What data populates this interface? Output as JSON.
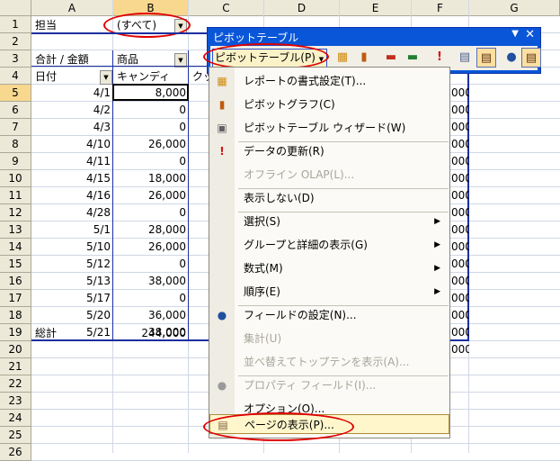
{
  "columns": [
    "A",
    "B",
    "C",
    "D",
    "E",
    "F",
    "G"
  ],
  "rows": [
    "1",
    "2",
    "3",
    "4",
    "5",
    "6",
    "7",
    "8",
    "9",
    "10",
    "11",
    "12",
    "13",
    "14",
    "15",
    "16",
    "17",
    "18",
    "19",
    "20",
    "21",
    "22",
    "23",
    "24",
    "25",
    "26"
  ],
  "page_field": {
    "label": "担当",
    "value": "(すべて)"
  },
  "pivot_header": {
    "data_label": "合計 / 金額",
    "col_field": "商品",
    "row_field": "日付",
    "col_item_b": "キャンディ",
    "col_item_c": "クッ"
  },
  "data_rows": [
    {
      "date": "4/1",
      "value": "8,000"
    },
    {
      "date": "4/2",
      "value": "0"
    },
    {
      "date": "4/3",
      "value": "0"
    },
    {
      "date": "4/10",
      "value": "26,000"
    },
    {
      "date": "4/11",
      "value": "0"
    },
    {
      "date": "4/15",
      "value": "18,000"
    },
    {
      "date": "4/16",
      "value": "26,000"
    },
    {
      "date": "4/28",
      "value": "0"
    },
    {
      "date": "5/1",
      "value": "28,000"
    },
    {
      "date": "5/10",
      "value": "26,000"
    },
    {
      "date": "5/12",
      "value": "0"
    },
    {
      "date": "5/13",
      "value": "38,000"
    },
    {
      "date": "5/17",
      "value": "0"
    },
    {
      "date": "5/20",
      "value": "36,000"
    },
    {
      "date": "5/21",
      "value": "38,000"
    }
  ],
  "total_row": {
    "label": "総計",
    "value": "244,000"
  },
  "col_f_partial": "000",
  "toolbar": {
    "title": "ピボットテーブル",
    "menu_button": "ピボットテーブル(P)"
  },
  "menu": [
    {
      "label": "レポートの書式設定(T)...",
      "icon": "format-report-icon"
    },
    {
      "label": "ピボットグラフ(C)",
      "icon": "pivot-chart-icon"
    },
    {
      "label": "ピボットテーブル ウィザード(W)",
      "icon": "wizard-icon"
    },
    {
      "label": "データの更新(R)",
      "icon": "refresh-icon"
    },
    {
      "label": "オフライン OLAP(L)...",
      "icon": ""
    },
    {
      "label": "表示しない(D)",
      "icon": ""
    },
    {
      "label": "選択(S)",
      "icon": ""
    },
    {
      "label": "グループと詳細の表示(G)",
      "icon": ""
    },
    {
      "label": "数式(M)",
      "icon": ""
    },
    {
      "label": "順序(E)",
      "icon": ""
    },
    {
      "label": "フィールドの設定(N)...",
      "icon": "field-settings-icon"
    },
    {
      "label": "集計(U)",
      "icon": ""
    },
    {
      "label": "並べ替えてトップテンを表示(A)...",
      "icon": ""
    },
    {
      "label": "プロパティ フィールド(I)...",
      "icon": "property-field-icon"
    },
    {
      "label": "オプション(O)...",
      "icon": ""
    },
    {
      "label": "ページの表示(P)...",
      "icon": "show-pages-icon"
    }
  ],
  "colors": {
    "accent": "#0a56d8",
    "highlight": "#fff6cc",
    "annotation": "#e00000"
  }
}
